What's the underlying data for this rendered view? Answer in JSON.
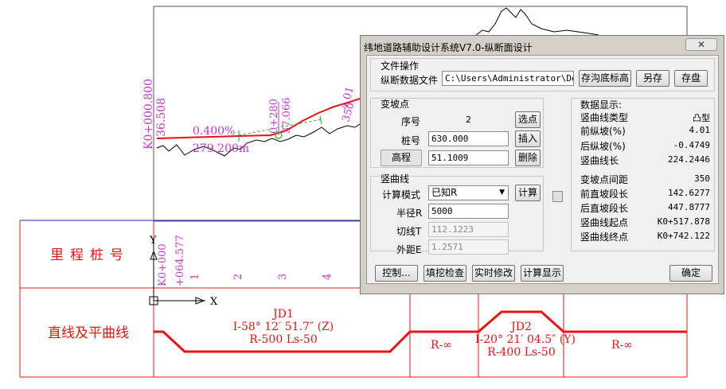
{
  "cad": {
    "profile_labels": {
      "start_station": "K0+000.800",
      "start_elev": "36.508",
      "grade": "0.400%",
      "grade_length": "279.200m",
      "pvi_station": "0+280",
      "pvi_elev": "37.066",
      "grade2": "4.01",
      "grade2_length": "350"
    },
    "ucs": {
      "y": "Y",
      "x": "X"
    },
    "rows": {
      "stake_label": "里程桩号",
      "alignment_label": "直线及平曲线"
    },
    "stake": {
      "start": "K0+000",
      "offset": "+064.577",
      "ticks": [
        "1",
        "2",
        "3",
        "4"
      ]
    },
    "jd1": {
      "name": "JD1",
      "angle": "I-58° 12′ 51.7″ (Z)",
      "params": "R-500  Ls-50"
    },
    "jd2": {
      "name": "JD2",
      "angle": "I-20° 21′ 04.5″ (Y)",
      "params": "R-400  Ls-50"
    },
    "r_inf_1": "R-∞",
    "r_inf_2": "R-∞",
    "colors": {
      "red": "#ee1111",
      "magenta": "#cc33cc",
      "green": "#22aa22",
      "blue": "#2222cc"
    }
  },
  "dialog": {
    "title": "纬地道路辅助设计系统V7.0-纵断面设计",
    "close_icon": "close-icon",
    "file_ops": {
      "legend": "文件操作",
      "file_label": "纵断数据文件",
      "file_path": "C:\\Users\\Administrator\\Desk",
      "btn_ground": "存沟底标高",
      "btn_saveas": "另存",
      "btn_save": "存盘"
    },
    "pvi": {
      "legend": "变坡点",
      "seq_label": "序号",
      "seq_value": "2",
      "btn_select": "选点",
      "station_label": "桩号",
      "station_value": "630.000",
      "btn_insert": "插入",
      "elev_label": "高程",
      "elev_value": "51.1009",
      "btn_delete": "删除"
    },
    "vcurve": {
      "legend": "竖曲线",
      "mode_label": "计算模式",
      "mode_value": "已知R",
      "btn_calc": "计算",
      "radius_label": "半径R",
      "radius_value": "5000",
      "tangent_label": "切线T",
      "tangent_value": "112.1223",
      "external_label": "外距E",
      "external_value": "1.2571"
    },
    "display": {
      "legend": "数据显示:",
      "rows": [
        {
          "label": "竖曲线类型",
          "value": "凸型"
        },
        {
          "label": "前纵坡(%)",
          "value": "4.01"
        },
        {
          "label": "后纵坡(%)",
          "value": "-0.4749"
        },
        {
          "label": "竖曲线长",
          "value": "224.2446"
        },
        {
          "label": "变坡点间距",
          "value": "350"
        },
        {
          "label": "前直坡段长",
          "value": "142.6277"
        },
        {
          "label": "后直坡段长",
          "value": "447.8777"
        },
        {
          "label": "竖曲线起点",
          "value": "K0+517.878"
        },
        {
          "label": "竖曲线终点",
          "value": "K0+742.122"
        }
      ]
    },
    "footer": {
      "btn_control": "控制...",
      "btn_cutfill": "填挖检查",
      "btn_realtime": "实时修改",
      "btn_calcdisp": "计算显示",
      "btn_ok": "确定"
    }
  }
}
